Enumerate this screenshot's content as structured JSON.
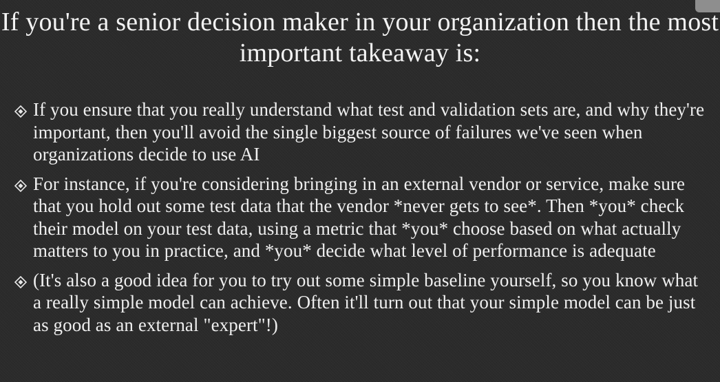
{
  "slide": {
    "title": "If you're a senior decision maker in your organization then the most important takeaway is:",
    "bullets": [
      {
        "icon": "diamond-bullet-icon",
        "text": "If you ensure that you really understand what test and validation sets are, and why they're important, then you'll avoid the single biggest source of failures we've seen when organizations decide to use AI"
      },
      {
        "icon": "diamond-bullet-icon",
        "text": "For instance, if you're considering bringing in an external vendor or service, make sure that you hold out some test data that the vendor *never gets to see*. Then *you* check their model on your test data, using a metric that *you* choose based on what actually matters to you in practice, and *you* decide what level of performance is adequate"
      },
      {
        "icon": "diamond-bullet-icon",
        "text": "(It's also a good idea for you to try out some simple baseline yourself, so you know what a really simple model can achieve. Often it'll turn out that your simple model can be just as good as an external \"expert\"!)"
      }
    ]
  },
  "colors": {
    "background": "#2b2b2b",
    "text": "#f1f1f1",
    "corner_thumb": "#8e8e8e"
  }
}
